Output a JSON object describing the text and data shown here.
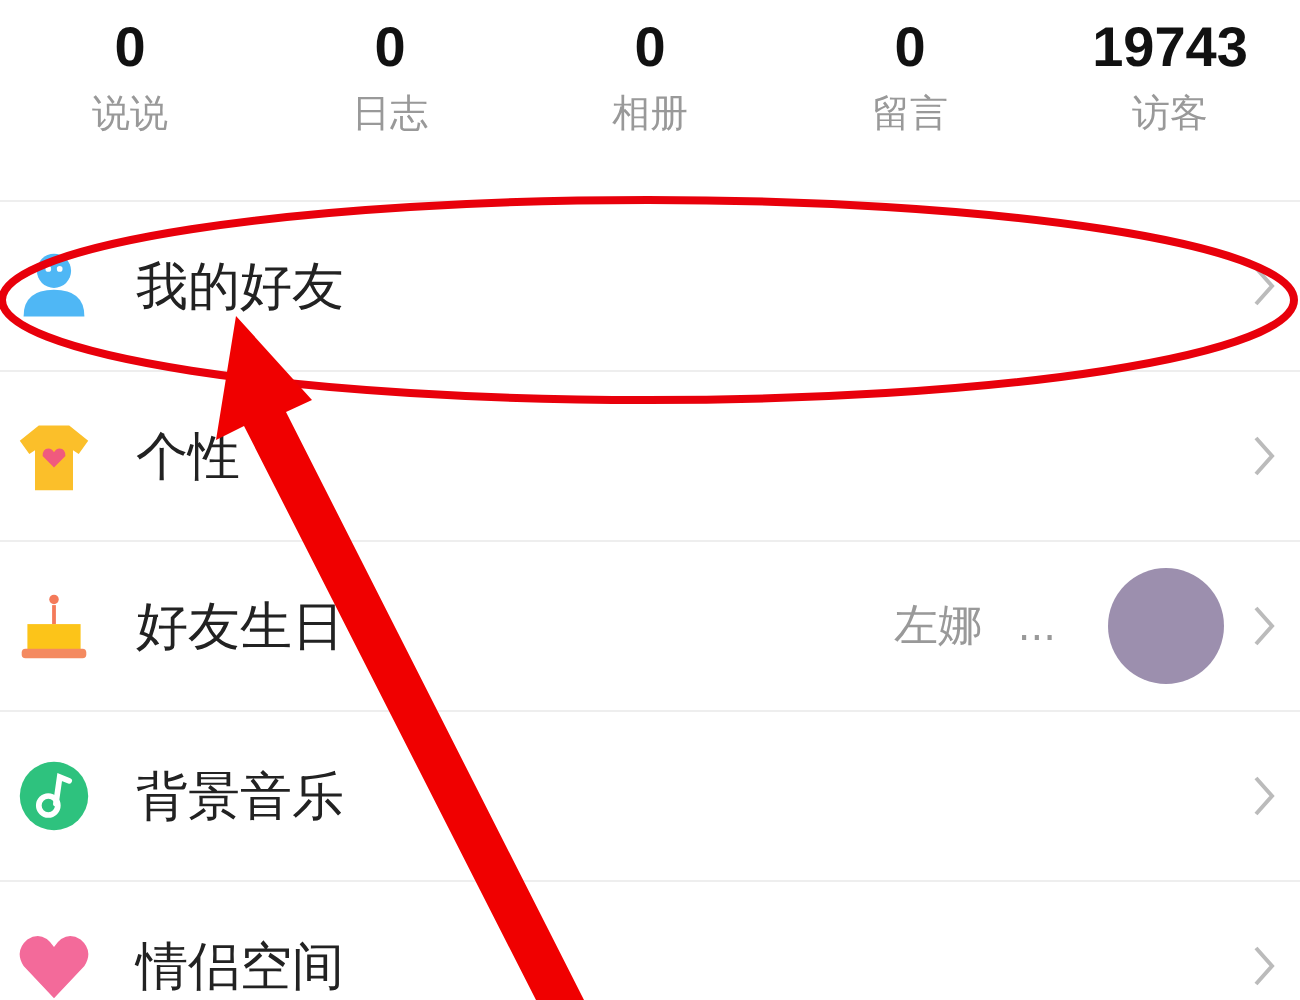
{
  "stats": [
    {
      "value": "0",
      "label": "说说"
    },
    {
      "value": "0",
      "label": "日志"
    },
    {
      "value": "0",
      "label": "相册"
    },
    {
      "value": "0",
      "label": "留言"
    },
    {
      "value": "19743",
      "label": "访客"
    }
  ],
  "menu": [
    {
      "kind": "friends",
      "label": "我的好友"
    },
    {
      "kind": "personalize",
      "label": "个性"
    },
    {
      "kind": "birthday",
      "label": "好友生日",
      "detail": "左娜",
      "more": "...",
      "avatar": true
    },
    {
      "kind": "music",
      "label": "背景音乐"
    },
    {
      "kind": "couple",
      "label": "情侣空间"
    }
  ]
}
